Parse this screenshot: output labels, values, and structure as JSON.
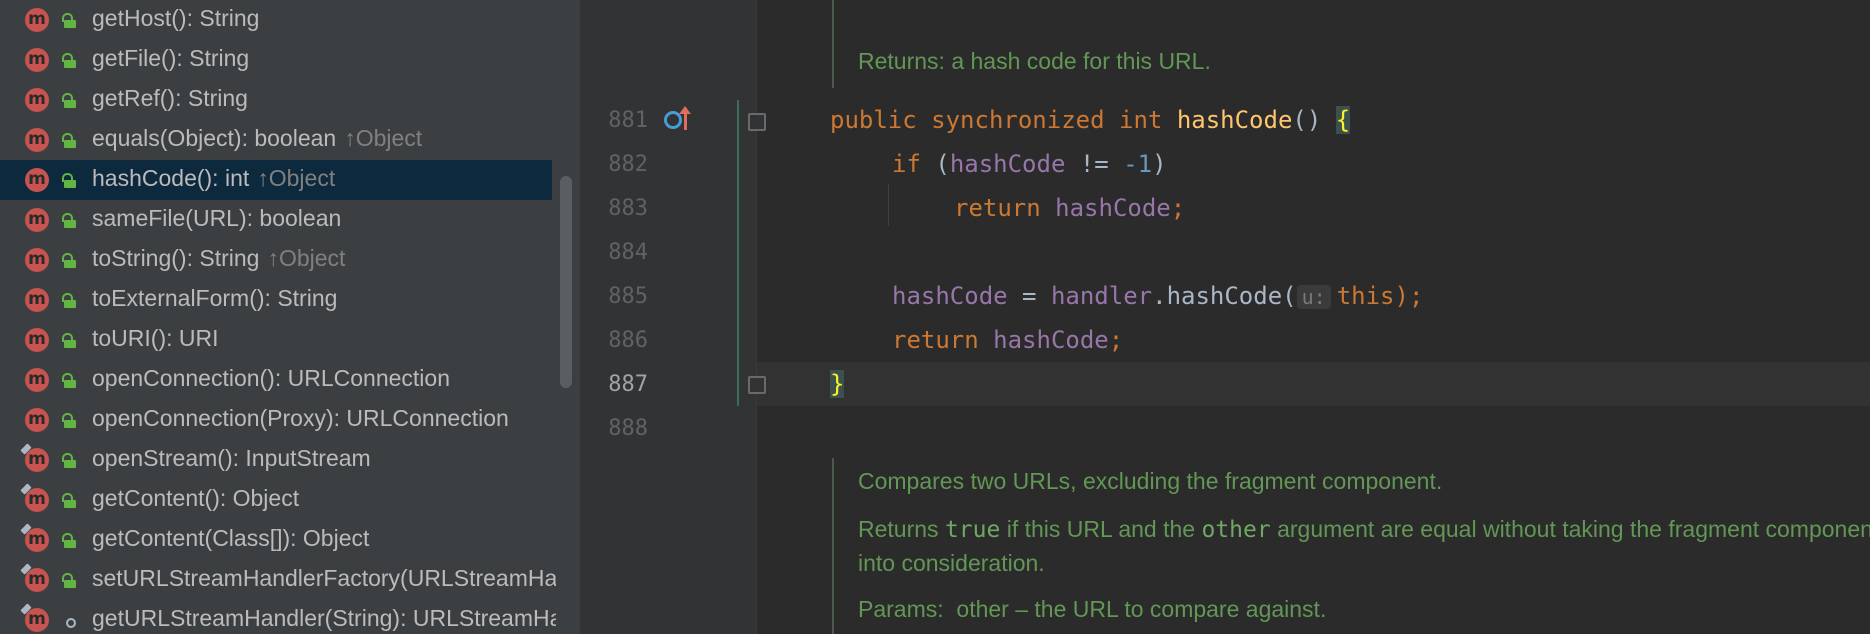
{
  "structure": {
    "members": [
      {
        "signature": "getHost(): String",
        "inherited": "",
        "visibility": "public",
        "icon": "method-icon"
      },
      {
        "signature": "getFile(): String",
        "inherited": "",
        "visibility": "public",
        "icon": "method-icon"
      },
      {
        "signature": "getRef(): String",
        "inherited": "",
        "visibility": "public",
        "icon": "method-icon"
      },
      {
        "signature": "equals(Object): boolean",
        "inherited": "↑Object",
        "visibility": "public",
        "icon": "method-icon"
      },
      {
        "signature": "hashCode(): int",
        "inherited": "↑Object",
        "visibility": "public",
        "icon": "method-icon",
        "selected": true
      },
      {
        "signature": "sameFile(URL): boolean",
        "inherited": "",
        "visibility": "public",
        "icon": "method-icon"
      },
      {
        "signature": "toString(): String",
        "inherited": "↑Object",
        "visibility": "public",
        "icon": "method-icon"
      },
      {
        "signature": "toExternalForm(): String",
        "inherited": "",
        "visibility": "public",
        "icon": "method-icon"
      },
      {
        "signature": "toURI(): URI",
        "inherited": "",
        "visibility": "public",
        "icon": "method-icon"
      },
      {
        "signature": "openConnection(): URLConnection",
        "inherited": "",
        "visibility": "public",
        "icon": "method-icon"
      },
      {
        "signature": "openConnection(Proxy): URLConnection",
        "inherited": "",
        "visibility": "public",
        "icon": "method-icon"
      },
      {
        "signature": "openStream(): InputStream",
        "inherited": "",
        "visibility": "public",
        "icon": "final-method-icon"
      },
      {
        "signature": "getContent(): Object",
        "inherited": "",
        "visibility": "public",
        "icon": "final-method-icon"
      },
      {
        "signature": "getContent(Class[]): Object",
        "inherited": "",
        "visibility": "public",
        "icon": "final-method-icon"
      },
      {
        "signature": "setURLStreamHandlerFactory(URLStreamHandlerFactory): void",
        "inherited": "",
        "visibility": "public",
        "icon": "static-method-icon"
      },
      {
        "signature": "getURLStreamHandler(String): URLStreamHandler",
        "inherited": "",
        "visibility": "package",
        "icon": "static-method-icon"
      }
    ]
  },
  "editor": {
    "doc_above": {
      "label": "Returns:",
      "text": "a hash code for this URL."
    },
    "lines": [
      {
        "num": "881"
      },
      {
        "num": "882"
      },
      {
        "num": "883"
      },
      {
        "num": "884"
      },
      {
        "num": "885"
      },
      {
        "num": "886"
      },
      {
        "num": "887"
      },
      {
        "num": "888"
      }
    ],
    "code": {
      "l881": {
        "kw1": "public",
        "kw2": "synchronized",
        "kw3": "int",
        "name": "hashCode",
        "parens": "() ",
        "brace": "{"
      },
      "l882": {
        "kw": "if",
        "open": " (",
        "field": "hashCode",
        "op": " != ",
        "num": "-1",
        "close": ")"
      },
      "l883": {
        "kw": "return",
        "field": "hashCode",
        "semi": ";"
      },
      "l885": {
        "field": "hashCode",
        "eq": " = ",
        "handler": "handler",
        "dot": ".",
        "call": "hashCode(",
        "hint": "u:",
        "this": "this",
        "end": ");"
      },
      "l886": {
        "kw": "return",
        "field": "hashCode",
        "semi": ";"
      },
      "l887": {
        "brace": "}"
      }
    },
    "doc_below": {
      "summary": "Compares two URLs, excluding the fragment component.",
      "returns_pre": "Returns ",
      "returns_code1": "true",
      "returns_mid": " if this URL and the ",
      "returns_code2": "other",
      "returns_post": " argument are equal without taking the fragment component",
      "returns_line2": "into consideration.",
      "params_label": "Params:",
      "params_text": "other – the URL to compare against."
    }
  }
}
